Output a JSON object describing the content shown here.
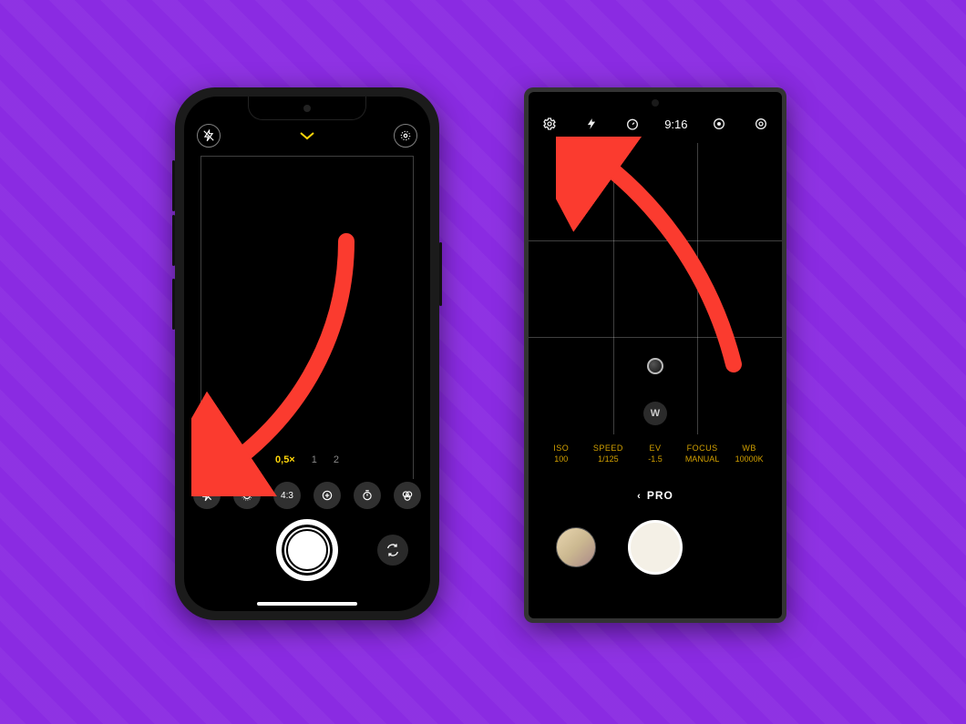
{
  "iphone": {
    "zoom": {
      "level_a": "0,5×",
      "level_b": "1",
      "level_c": "2"
    },
    "options": {
      "aspect": "4:3"
    }
  },
  "samsung": {
    "time": "9:16",
    "lens": "W",
    "params": {
      "iso": {
        "label": "ISO",
        "value": "100"
      },
      "speed": {
        "label": "SPEED",
        "value": "1/125"
      },
      "ev": {
        "label": "EV",
        "value": "-1.5"
      },
      "focus": {
        "label": "FOCUS",
        "value": "MANUAL"
      },
      "wb": {
        "label": "WB",
        "value": "10000K"
      }
    },
    "mode": "PRO"
  }
}
